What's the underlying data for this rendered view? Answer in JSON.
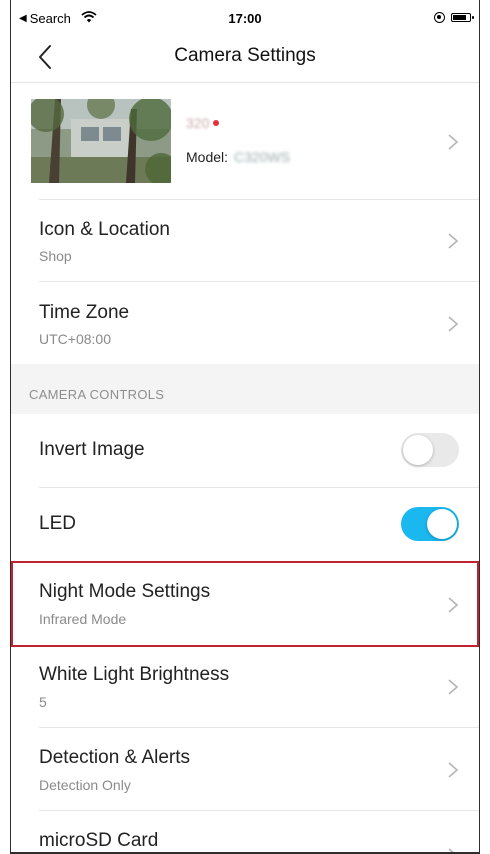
{
  "status_bar": {
    "back_app": "Search",
    "time": "17:00",
    "icons": [
      "wifi-icon",
      "orientation-lock-icon",
      "battery-icon"
    ]
  },
  "nav": {
    "title": "Camera Settings",
    "back_icon": "chevron-left-icon"
  },
  "device": {
    "name": "320",
    "model_label": "Model:",
    "model_value": "C320WS",
    "status_color": "#e8303a"
  },
  "rows_top": [
    {
      "label": "Icon & Location",
      "sub": "Shop"
    },
    {
      "label": "Time Zone",
      "sub": "UTC+08:00"
    }
  ],
  "section": {
    "title": "CAMERA CONTROLS"
  },
  "controls": {
    "invert_image": {
      "label": "Invert Image",
      "on": false
    },
    "led": {
      "label": "LED",
      "on": true
    }
  },
  "rows_bottom": [
    {
      "label": "Night Mode Settings",
      "sub": "Infrared Mode",
      "highlighted": true
    },
    {
      "label": "White Light Brightness",
      "sub": "5"
    },
    {
      "label": "Detection & Alerts",
      "sub": "Detection Only"
    },
    {
      "label": "microSD Card",
      "sub": ""
    }
  ],
  "colors": {
    "accent": "#1ab8ee",
    "highlight": "#c0232f",
    "section_bg": "#f4f4f4"
  }
}
